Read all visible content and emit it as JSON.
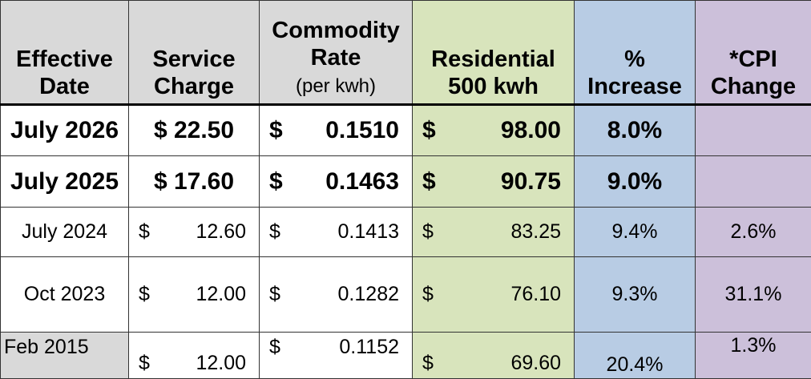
{
  "table": {
    "headers": {
      "date": [
        "Effective",
        "Date"
      ],
      "service": [
        "Service",
        "Charge"
      ],
      "rate": [
        "Commodity",
        "Rate",
        "(per kwh)"
      ],
      "residential": [
        "Residential",
        "500 kwh"
      ],
      "increase": [
        "%",
        "Increase"
      ],
      "cpi": [
        "*CPI",
        "Change"
      ]
    },
    "rows": [
      {
        "date": "July 2026",
        "service_sym": "$",
        "service": "22.50",
        "rate_sym": "$",
        "rate": "0.1510",
        "res_sym": "$",
        "residential": "98.00",
        "increase": "8.0%",
        "cpi": ""
      },
      {
        "date": "July 2025",
        "service_sym": "$",
        "service": "17.60",
        "rate_sym": "$",
        "rate": "0.1463",
        "res_sym": "$",
        "residential": "90.75",
        "increase": "9.0%",
        "cpi": ""
      },
      {
        "date": "July 2024",
        "service_sym": "$",
        "service": "12.60",
        "rate_sym": "$",
        "rate": "0.1413",
        "res_sym": "$",
        "residential": "83.25",
        "increase": "9.4%",
        "cpi": "2.6%"
      },
      {
        "date": "Oct 2023",
        "service_sym": "$",
        "service": "12.00",
        "rate_sym": "$",
        "rate": "0.1282",
        "res_sym": "$",
        "residential": "76.10",
        "increase": "9.3%",
        "cpi": "31.1%"
      },
      {
        "date": "Feb 2015",
        "service_sym": "$",
        "service": "12.00",
        "rate_sym": "$",
        "rate": "0.1152",
        "res_sym": "$",
        "residential": "69.60",
        "increase": "20.4%",
        "cpi": "1.3%"
      }
    ]
  },
  "colors": {
    "header_gray": "#d9d9d9",
    "residential_green": "#d8e4bc",
    "increase_blue": "#b8cce4",
    "cpi_purple": "#ccc0da"
  }
}
